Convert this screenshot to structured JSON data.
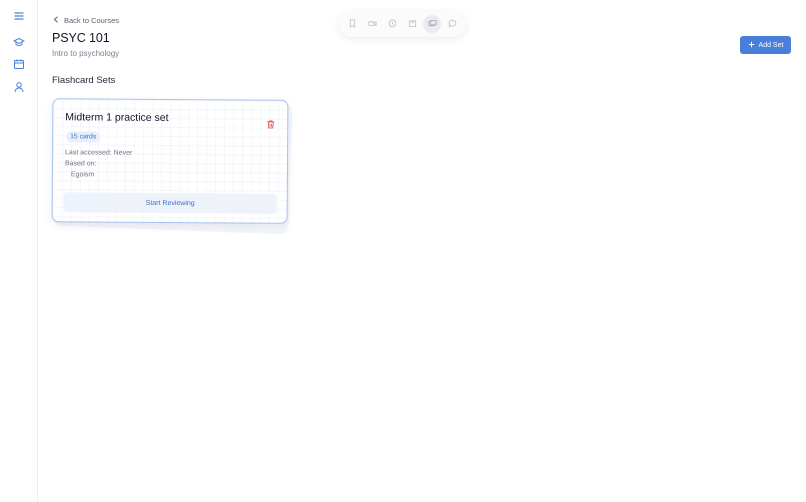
{
  "sidebar": {
    "items": [
      {
        "icon": "menu-icon"
      },
      {
        "icon": "graduation-cap-icon"
      },
      {
        "icon": "calendar-icon"
      },
      {
        "icon": "user-icon"
      }
    ]
  },
  "toolbar": {
    "tools": [
      {
        "icon": "bookmark-icon"
      },
      {
        "icon": "video-icon"
      },
      {
        "icon": "clock-icon"
      },
      {
        "icon": "puzzle-icon"
      },
      {
        "icon": "flashcards-icon",
        "active": true
      },
      {
        "icon": "chat-icon"
      }
    ]
  },
  "header": {
    "back_label": "Back to Courses",
    "course_code": "PSYC 101",
    "course_name": "Intro to psychology"
  },
  "actions": {
    "add_set_label": "Add Set"
  },
  "section": {
    "title": "Flashcard Sets"
  },
  "flashcard_sets": [
    {
      "title": "Midterm 1 practice set",
      "card_count": "15 cards",
      "last_accessed": "Last accessed: Never",
      "based_on_label": "Based on:",
      "based_on_value": "Egoism",
      "start_label": "Start Reviewing"
    }
  ],
  "colors": {
    "accent": "#4a7fd9",
    "badge_bg": "#e8f0fc",
    "card_border": "#a9c3ee",
    "danger": "#e05252"
  }
}
